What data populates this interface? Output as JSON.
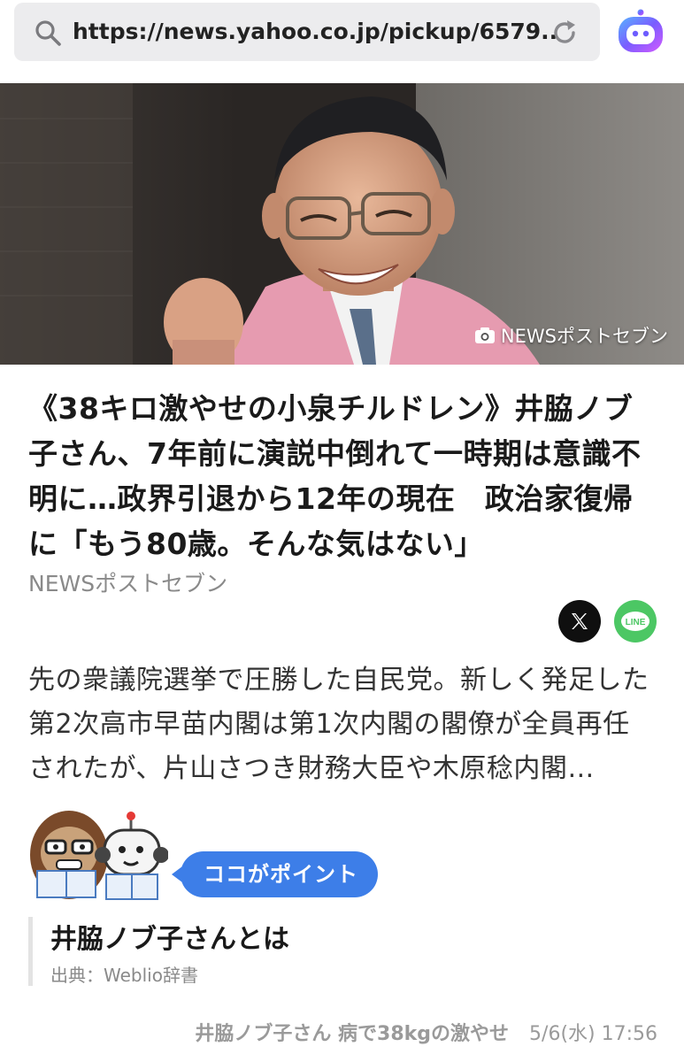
{
  "browser": {
    "url": "https://news.yahoo.co.jp/pickup/6579...",
    "icons": {
      "search": "search-icon",
      "reload": "reload-icon",
      "assistant": "assistant-icon"
    }
  },
  "hero": {
    "image": "portrait-photo",
    "credit": "NEWSポストセブン",
    "credit_icon": "camera-icon"
  },
  "article": {
    "headline": "《38キロ激やせの小泉チルドレン》井脇ノブ子さん、7年前に演説中倒れて一時期は意識不明に…政界引退から12年の現在　政治家復帰に「もう80歳。そんな気はない」",
    "source": "NEWSポストセブン",
    "summary": "先の衆議院選挙で圧勝した自民党。新しく発足した第2次高市早苗内閣は第1次内閣の閣僚が全員再任されたが、片山さつき財務大臣や木原稔内閣…",
    "share": {
      "x_icon": "x-icon",
      "line_label": "LINE"
    }
  },
  "point": {
    "badge": "ココがポイント",
    "title": "井脇ノブ子さんとは",
    "cite": "出典：Weblio辞書"
  },
  "footer": {
    "title": "井脇ノブ子さん 病で38kgの激やせ",
    "date": "5/6(水) 17:56"
  },
  "colors": {
    "accent_blue": "#3d7ee8",
    "line_green": "#4cc764",
    "x_black": "#0f0f0f"
  }
}
